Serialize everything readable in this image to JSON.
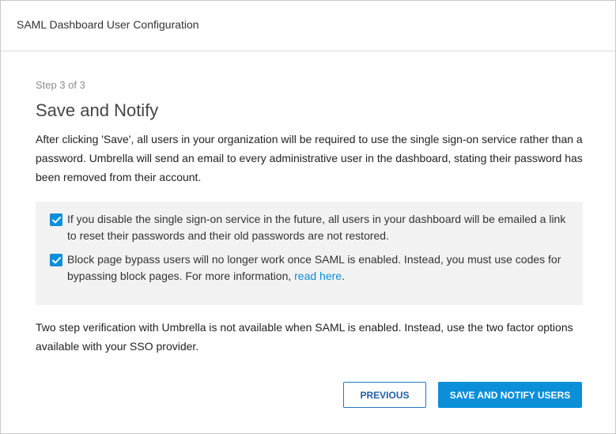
{
  "dialog": {
    "title": "SAML Dashboard User Configuration"
  },
  "step": {
    "label": "Step 3 of 3",
    "heading": "Save and Notify"
  },
  "intro": "After clicking 'Save', all users in your organization will be required to use the single sign-on service rather than a password. Umbrella will send an email to every administrative user in the dashboard, stating their password has been removed from their account.",
  "acknowledgements": [
    {
      "checked": true,
      "text": "If you disable the single sign-on service in the future, all users in your dashboard will be emailed a link to reset their passwords and their old passwords are not restored."
    },
    {
      "checked": true,
      "text": "Block page bypass users will no longer work once SAML is enabled. Instead, you must use codes for bypassing block pages. For more information, ",
      "link_text": "read here",
      "after_link": "."
    }
  ],
  "footnote": "Two step verification with Umbrella is not available when SAML is enabled. Instead, use the two factor options available with your SSO provider.",
  "buttons": {
    "previous": "PREVIOUS",
    "save": "SAVE AND NOTIFY USERS"
  },
  "colors": {
    "accent": "#0a8fd8",
    "panel_bg": "#f2f2f2",
    "secondary_button_border": "#1f78c8"
  }
}
